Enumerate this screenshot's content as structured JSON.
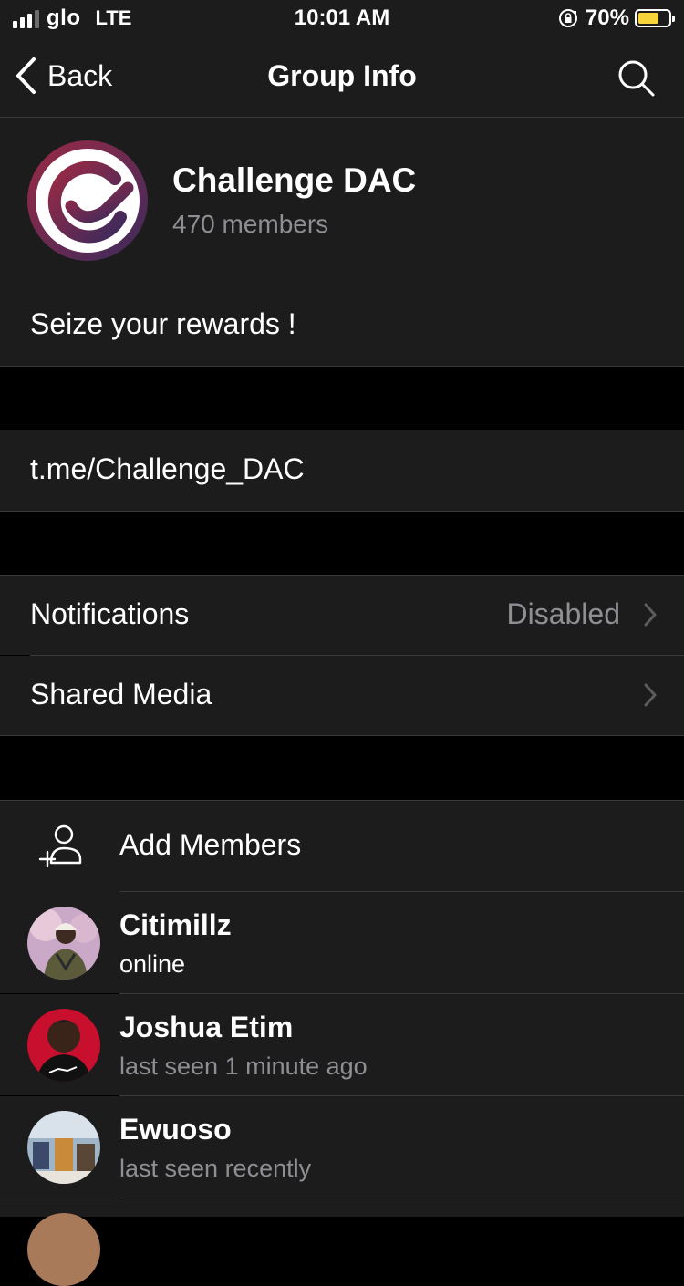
{
  "status_bar": {
    "carrier": "glo",
    "network": "LTE",
    "time": "10:01 AM",
    "battery_percent": "70%",
    "battery_level": 0.7
  },
  "nav": {
    "back_label": "Back",
    "title": "Group Info"
  },
  "group": {
    "name": "Challenge DAC",
    "members_text": "470 members",
    "description": "Seize your rewards !",
    "link": "t.me/Challenge_DAC"
  },
  "settings": {
    "notifications_label": "Notifications",
    "notifications_value": "Disabled",
    "shared_media_label": "Shared Media"
  },
  "members_section": {
    "add_members_label": "Add Members",
    "members": [
      {
        "name": "Citimillz",
        "status": "online"
      },
      {
        "name": "Joshua Etim",
        "status": "last seen 1 minute ago"
      },
      {
        "name": "Ewuoso",
        "status": "last seen recently"
      }
    ]
  },
  "colors": {
    "background": "#000000",
    "cell": "#1c1c1d",
    "separator": "#3a3a3c",
    "secondary_text": "#8e8e93",
    "online": "#ffffff",
    "battery_fill": "#f7d43a"
  }
}
